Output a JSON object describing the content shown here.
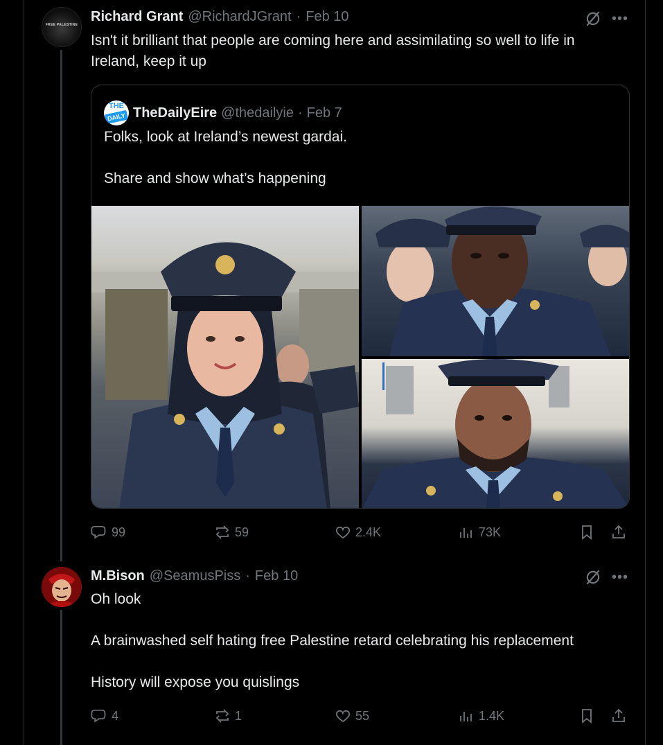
{
  "tweet1": {
    "name": "Richard Grant",
    "handle": "@RichardJGrant",
    "separator": "·",
    "date": "Feb 10",
    "avatar_text": "FREE PALESTINE",
    "text_lines": [
      "Isn't it brilliant that people are coming here and assimilating so well to life in",
      "Ireland,  keep it up"
    ],
    "quote": {
      "name": "TheDailyEire",
      "handle": "@thedailyie",
      "separator": "·",
      "date": "Feb 7",
      "avatar_top": "THE",
      "avatar_bottom": "DAILY",
      "text_lines": [
        "Folks, look at Ireland’s newest gardai.",
        "",
        "Share and show what’s happening"
      ]
    },
    "stats": {
      "replies": "99",
      "reposts": "59",
      "likes": "2.4K",
      "views": "73K"
    }
  },
  "tweet2": {
    "name": "M.Bison",
    "handle": "@SeamusPiss",
    "separator": "·",
    "date": "Feb 10",
    "text_lines": [
      "Oh look",
      "",
      "A brainwashed self hating free Palestine retard celebrating his replacement",
      "",
      "History will expose you quislings"
    ],
    "stats": {
      "replies": "4",
      "reposts": "1",
      "likes": "55",
      "views": "1.4K"
    }
  },
  "colors": {
    "background": "#000000",
    "text": "#e7e9ea",
    "muted": "#71767b",
    "border": "#2f3336"
  }
}
